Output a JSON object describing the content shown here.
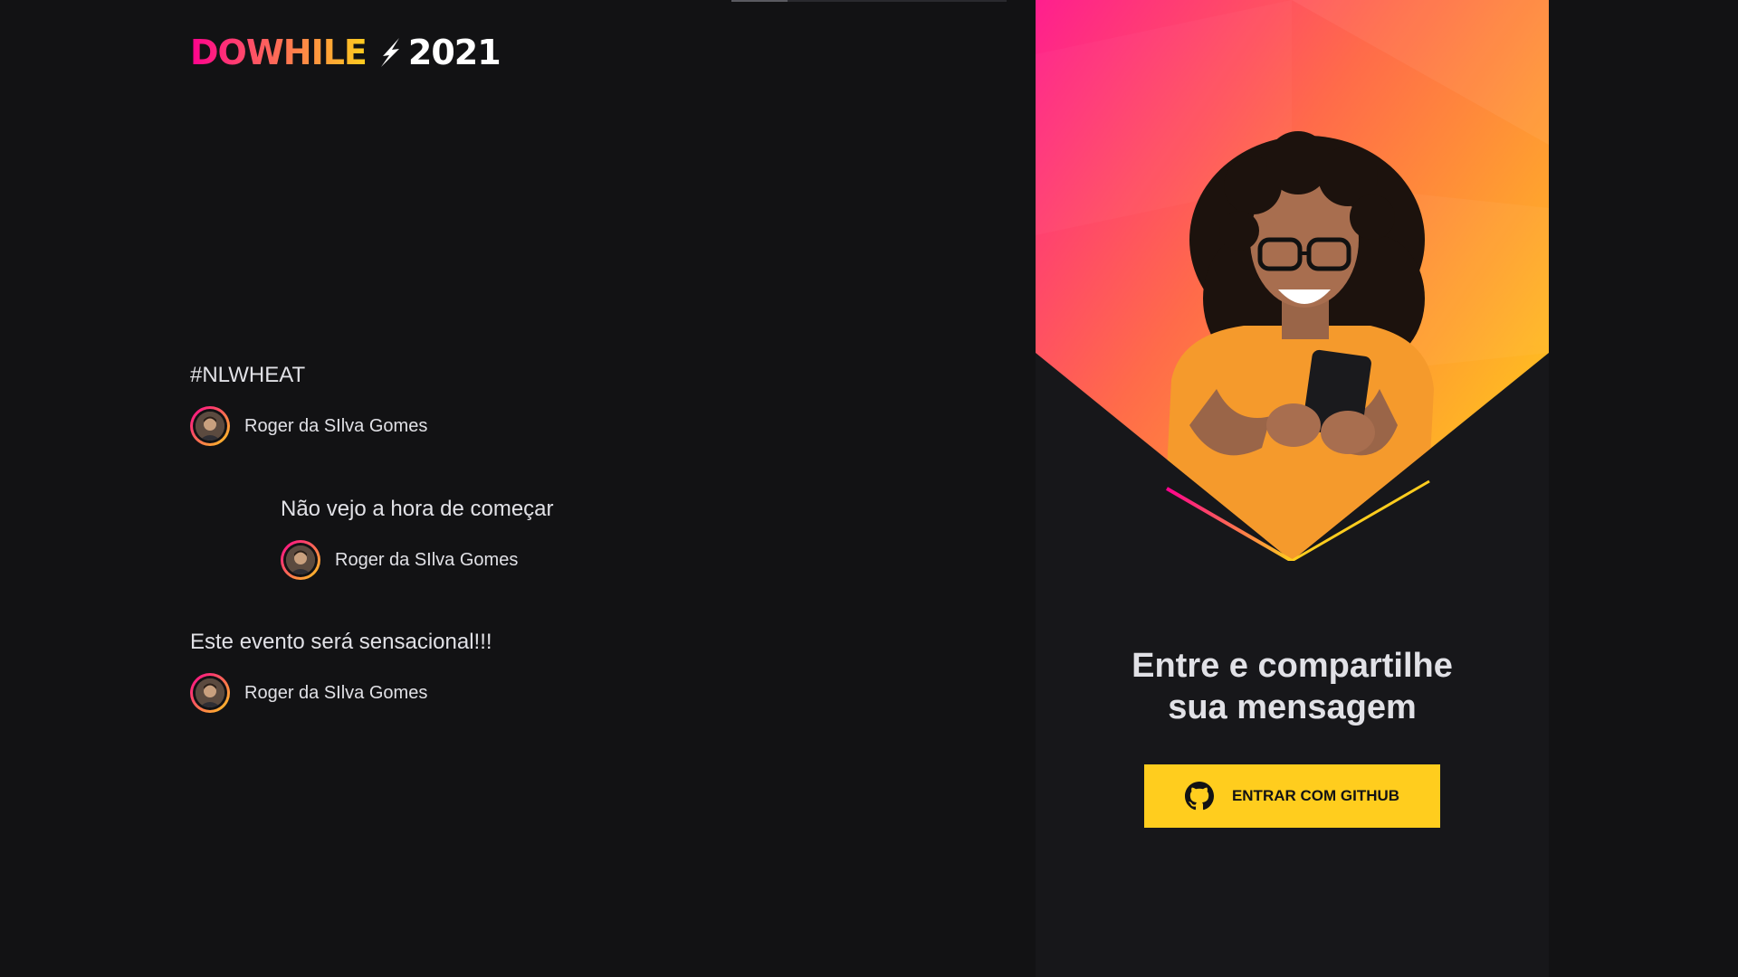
{
  "brand": {
    "logo_part1": "DO",
    "logo_part2": "WHILE",
    "logo_year": "2021"
  },
  "messages": [
    {
      "text": "#NLWHEAT",
      "user": "Roger da SIlva Gomes"
    },
    {
      "text": "Não vejo a hora de começar",
      "user": "Roger da SIlva Gomes"
    },
    {
      "text": "Este evento será sensacional!!!",
      "user": "Roger da SIlva Gomes"
    }
  ],
  "login": {
    "title_line1": "Entre e compartilhe",
    "title_line2": "sua mensagem",
    "button_label": "ENTRAR COM GITHUB",
    "button_icon": "github-icon"
  },
  "colors": {
    "background": "#121214",
    "panel": "#17171a",
    "accent_yellow": "#ffcd1e",
    "accent_pink": "#ff008e",
    "text": "#e1e1e6"
  }
}
